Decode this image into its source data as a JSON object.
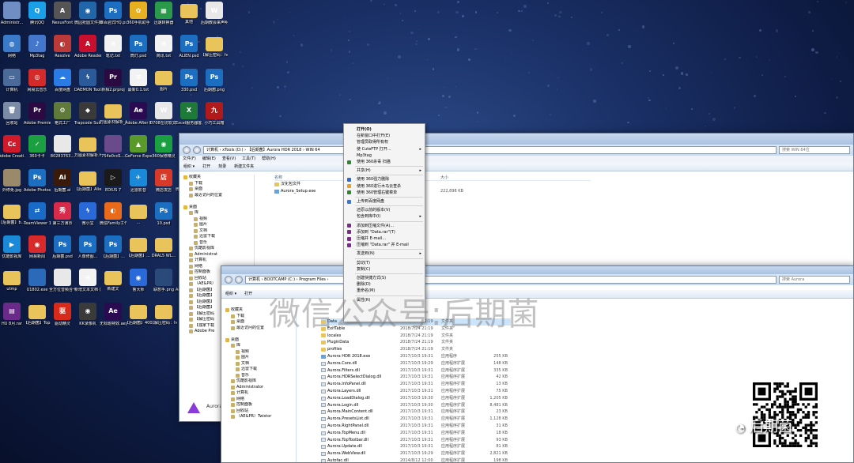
{
  "desktop": {
    "icons": [
      {
        "label": "Administr...",
        "glyph": "",
        "color": "#6f8fc4"
      },
      {
        "label": "腾讯QQ",
        "glyph": "Q",
        "color": "#1aa0e8"
      },
      {
        "label": "NexusFont",
        "glyph": "A",
        "color": "#555555"
      },
      {
        "label": "微园抢圆文件夹.exe",
        "glyph": "◉",
        "color": "#2266aa"
      },
      {
        "label": "谁百验式HQ.psd",
        "glyph": "Ps",
        "color": "#1c6fc0"
      },
      {
        "label": "360手机助手",
        "glyph": "✿",
        "color": "#e6b020"
      },
      {
        "label": "迅速转换器",
        "glyph": "▦",
        "color": "#2a9a4a"
      },
      {
        "label": "其他",
        "glyph": "",
        "color": "#e8c45a"
      },
      {
        "label": "后期教会来声明.docx",
        "glyph": "W",
        "color": "#e8e8e8"
      },
      {
        "label": "网络",
        "glyph": "◍",
        "color": "#3a7ac8"
      },
      {
        "label": "Mp3tag",
        "glyph": "♪",
        "color": "#4477cc"
      },
      {
        "label": "Resolve",
        "glyph": "◐",
        "color": "#ba3a3a"
      },
      {
        "label": "Adobe Reader XI",
        "glyph": "A",
        "color": "#c8102e"
      },
      {
        "label": "笔记.txt",
        "glyph": "≡",
        "color": "#f2f2f2"
      },
      {
        "label": "筒灯.psd",
        "glyph": "Ps",
        "color": "#1c6fc0"
      },
      {
        "label": "简讯.txt",
        "glyph": "≡",
        "color": "#f2f2f2"
      },
      {
        "label": "ALIEN.psd",
        "glyph": "Ps",
        "color": "#1c6fc0"
      },
      {
        "label": "【解压密码：houqi...",
        "glyph": "",
        "color": "#e8c45a"
      },
      {
        "label": "计算机",
        "glyph": "▭",
        "color": "#4a6a9a"
      },
      {
        "label": "网易云音乐",
        "glyph": "◎",
        "color": "#d32a2a"
      },
      {
        "label": "百度网盘",
        "glyph": "☁",
        "color": "#2b7be4"
      },
      {
        "label": "DAEMON Tools Lite",
        "glyph": "ϟ",
        "color": "#2a5a9a"
      },
      {
        "label": "新相2.prproj",
        "glyph": "Pr",
        "color": "#2a0a40"
      },
      {
        "label": "最新0.1.txt",
        "glyph": "≡",
        "color": "#f2f2f2"
      },
      {
        "label": "图片",
        "glyph": "",
        "color": "#e8c45a"
      },
      {
        "label": "330.psd",
        "glyph": "Ps",
        "color": "#1c6fc0"
      },
      {
        "label": "后期菌.png",
        "glyph": "Ps",
        "color": "#1c6fc0"
      },
      {
        "label": "回收站",
        "glyph": "🗑",
        "color": "#7b8da6"
      },
      {
        "label": "Adobe Premie...",
        "glyph": "Pr",
        "color": "#2a0a40"
      },
      {
        "label": "格式工厂",
        "glyph": "⚙",
        "color": "#5f7a3a"
      },
      {
        "label": "Trapcode Suite 12.1...",
        "glyph": "◆",
        "color": "#3a3a3a"
      },
      {
        "label": "万图素材解析_files",
        "glyph": "",
        "color": "#e8c45a"
      },
      {
        "label": "Adobe After Effects CC ...",
        "glyph": "Ae",
        "color": "#2a0a50"
      },
      {
        "label": "0708在坊软文.docx",
        "glyph": "W",
        "color": "#e8e8e8"
      },
      {
        "label": "Excel服务器客户端",
        "glyph": "X",
        "color": "#1f7a3a"
      },
      {
        "label": "小巧工具箱",
        "glyph": "九",
        "color": "#b01a1a"
      },
      {
        "label": "Adobe Creati...",
        "glyph": "Cc",
        "color": "#d01a2a"
      },
      {
        "label": "360卡卡",
        "glyph": "✓",
        "color": "#1aa040"
      },
      {
        "label": "80283763...",
        "glyph": "",
        "color": "#e8e8e8"
      },
      {
        "label": "万图素材解析.html",
        "glyph": "",
        "color": "#e8c45a"
      },
      {
        "label": "754e0cd1...",
        "glyph": "",
        "color": "#6a4a8a"
      },
      {
        "label": "GeForce Experience",
        "glyph": "▲",
        "color": "#5a9a2a"
      },
      {
        "label": "360保修精灵",
        "glyph": "◉",
        "color": "#1aa040"
      },
      {
        "label": "8mg.jpg",
        "glyph": "",
        "color": "#5a6a8a"
      },
      {
        "label": "微小宝-微信运营助手",
        "glyph": "",
        "color": "#e8e8e8"
      },
      {
        "label": "外修免.jpg",
        "glyph": "",
        "color": "#9a8a6a"
      },
      {
        "label": "Adobe Photosh...",
        "glyph": "Ps",
        "color": "#1c6fc0"
      },
      {
        "label": "后期菌.ai",
        "glyph": "Ai",
        "color": "#3a1a0a"
      },
      {
        "label": "【后期菌】Alien Skin...",
        "glyph": "",
        "color": "#e8c45a"
      },
      {
        "label": "EDIUS 7",
        "glyph": "▷",
        "color": "#1a1a1a"
      },
      {
        "label": "迅雷影音",
        "glyph": "✈",
        "color": "#1a8ad8"
      },
      {
        "label": "微店发店",
        "glyph": "店",
        "color": "#d83a2a"
      },
      {
        "label": "微小宝-微信运营助手",
        "glyph": "",
        "color": "#e8c45a"
      },
      {
        "label": "360安全浏览器",
        "glyph": "e",
        "color": "#1aa040"
      },
      {
        "label": "【后期菌】b...",
        "glyph": "",
        "color": "#e8c45a"
      },
      {
        "label": "TeamViewer 13",
        "glyph": "⇄",
        "color": "#1a6ac8"
      },
      {
        "label": "第三方演示",
        "glyph": "秀",
        "color": "#d82a4a"
      },
      {
        "label": "微小宝",
        "glyph": "ϟ",
        "color": "#2a6ad8"
      },
      {
        "label": "微信Family工作平台",
        "glyph": "◐",
        "color": "#e86a1a"
      },
      {
        "label": "...",
        "glyph": "",
        "color": "#e8c45a"
      },
      {
        "label": "10.psd",
        "glyph": "Ps",
        "color": "#1c6fc0"
      },
      {
        "label": "【后期菌】...",
        "glyph": "▤",
        "color": "#6a2a8a"
      },
      {
        "label": "Internet Explorer",
        "glyph": "e",
        "color": "#1a7ad8"
      },
      {
        "label": "优酷影视库",
        "glyph": "▶",
        "color": "#1a8ad8"
      },
      {
        "label": "网易新闻",
        "glyph": "◉",
        "color": "#d82a2a"
      },
      {
        "label": "后期菌.psd",
        "glyph": "Ps",
        "color": "#1c6fc0"
      },
      {
        "label": "人像修图...",
        "glyph": "Ps",
        "color": "#1c6fc0"
      },
      {
        "label": "【后期菌】...",
        "glyph": "Ps",
        "color": "#1c6fc0"
      },
      {
        "label": "【后期菌】...",
        "glyph": "",
        "color": "#e8c45a"
      },
      {
        "label": "DRAL5 WL...",
        "glyph": "",
        "color": "#e8c45a"
      },
      {
        "label": "XPinstaller",
        "glyph": "X",
        "color": "#c82a1a"
      },
      {
        "label": "两个软件已发改规则",
        "glyph": "",
        "color": "#e8e8e8"
      },
      {
        "label": "utmp",
        "glyph": "",
        "color": "#e8c45a"
      },
      {
        "label": "U1802.exe",
        "glyph": "",
        "color": "#2a6ab8"
      },
      {
        "label": "全方位音频合一个月...",
        "glyph": "",
        "color": "#e8e8e8"
      },
      {
        "label": "新增文本文档 (2).txt",
        "glyph": "≡",
        "color": "#f2f2f2"
      },
      {
        "label": "新建文",
        "glyph": "",
        "color": "#e8c45a"
      },
      {
        "label": "鲁大师",
        "glyph": "◉",
        "color": "#2a6ad8"
      },
      {
        "label": "联想手.png",
        "glyph": "",
        "color": "#2a4a7a"
      },
      {
        "label": "Adobe Premie...",
        "glyph": "Pr",
        "color": "#2a0a40"
      },
      {
        "label": "腾讯视频",
        "glyph": "▶",
        "color": "#1a9ad8"
      },
      {
        "label": "HU 8月.rar",
        "glyph": "▤",
        "color": "#6a2a8a"
      },
      {
        "label": "【后期菌】Topaz Re...",
        "glyph": "",
        "color": "#e8c45a"
      },
      {
        "label": "驱动精灵",
        "glyph": "驱",
        "color": "#d82a1a"
      },
      {
        "label": "KK录像机",
        "glyph": "◉",
        "color": "#3a3a3a"
      },
      {
        "label": "无标题特效.aep",
        "glyph": "Ae",
        "color": "#2a0a50"
      },
      {
        "label": "【后期菌】400个文字...",
        "glyph": "",
        "color": "#e8c45a"
      },
      {
        "label": "【解压密码：houqj...",
        "glyph": "",
        "color": "#e8c45a"
      },
      {
        "label": "Aurora",
        "glyph": "▲",
        "color": "#8a3ad8"
      }
    ]
  },
  "window_back": {
    "address": "计算机 › xTools (D:) › 【后期菌】Aurora HDR 2018 › WIN 64",
    "search_placeholder": "搜索 WIN 64位",
    "menu": [
      "文件(F)",
      "编辑(E)",
      "查看(V)",
      "工具(T)",
      "帮助(H)"
    ],
    "toolbar": [
      "组织 ▾",
      "打开",
      "刻录",
      "新建文件夹"
    ],
    "column_name": "名称",
    "column_size": "大小",
    "nav": [
      {
        "label": "收藏夹",
        "level": 0
      },
      {
        "label": "下载",
        "level": 1
      },
      {
        "label": "桌面",
        "level": 1
      },
      {
        "label": "最近访问的位置",
        "level": 1
      },
      {
        "label": "",
        "level": 1
      },
      {
        "label": "桌面",
        "level": 0
      },
      {
        "label": "库",
        "level": 1
      },
      {
        "label": "视频",
        "level": 2
      },
      {
        "label": "图片",
        "level": 2
      },
      {
        "label": "文档",
        "level": 2
      },
      {
        "label": "迅雷下载",
        "level": 2
      },
      {
        "label": "音乐",
        "level": 2
      },
      {
        "label": "优酷影视库",
        "level": 1
      },
      {
        "label": "Administrat",
        "level": 1
      },
      {
        "label": "计算机",
        "level": 1
      },
      {
        "label": "网络",
        "level": 1
      },
      {
        "label": "控制面板",
        "level": 1
      },
      {
        "label": "回收站",
        "level": 1
      },
      {
        "label": "（AE&PR）",
        "level": 1
      },
      {
        "label": "【后期菌】",
        "level": 1
      },
      {
        "label": "【后期菌】",
        "level": 1
      },
      {
        "label": "【后期菌】",
        "level": 1
      },
      {
        "label": "【后期菌】",
        "level": 1
      },
      {
        "label": "【解压密码",
        "level": 1
      },
      {
        "label": "【解压密码",
        "level": 1
      },
      {
        "label": "【独家下载",
        "level": 1
      },
      {
        "label": "Adobe Pre",
        "level": 1
      }
    ],
    "files": [
      {
        "name": "汉化包文件",
        "size": "",
        "type": "folder"
      },
      {
        "name": "Aurora_Setup.exe",
        "size": "222,898 KB",
        "type": "exe"
      }
    ],
    "status_name": "Aurora"
  },
  "window_front": {
    "address": "计算机 › BOOTCAMP (C:) › Program Files ›",
    "search_placeholder": "搜索 Aurora",
    "toolbar": [
      "组织 ▾",
      "打开"
    ],
    "nav": [
      {
        "label": "收藏夹",
        "level": 0
      },
      {
        "label": "下载",
        "level": 1
      },
      {
        "label": "桌面",
        "level": 1
      },
      {
        "label": "最近访问的位置",
        "level": 1
      },
      {
        "label": "",
        "level": 1
      },
      {
        "label": "桌面",
        "level": 0
      },
      {
        "label": "库",
        "level": 1
      },
      {
        "label": "视频",
        "level": 2
      },
      {
        "label": "图片",
        "level": 2
      },
      {
        "label": "文档",
        "level": 2
      },
      {
        "label": "迅雷下载",
        "level": 2
      },
      {
        "label": "音乐",
        "level": 2
      },
      {
        "label": "优酷影视库",
        "level": 1
      },
      {
        "label": "Administrator",
        "level": 1
      },
      {
        "label": "计算机",
        "level": 1
      },
      {
        "label": "网络",
        "level": 1
      },
      {
        "label": "控制面板",
        "level": 1
      },
      {
        "label": "回收站",
        "level": 1
      },
      {
        "label": "（AE&PR）Twistor",
        "level": 1
      }
    ],
    "files": [
      {
        "name": "Data",
        "date": "2018/7/24 21:19",
        "kind": "文件夹",
        "size": "",
        "type": "folder",
        "selected": true
      },
      {
        "name": "ExifTable",
        "date": "2018/7/24 21:19",
        "kind": "文件夹",
        "size": "",
        "type": "folder"
      },
      {
        "name": "locales",
        "date": "2018/7/24 21:19",
        "kind": "文件夹",
        "size": "",
        "type": "folder"
      },
      {
        "name": "PluginData",
        "date": "2018/7/24 21:19",
        "kind": "文件夹",
        "size": "",
        "type": "folder"
      },
      {
        "name": "profiles",
        "date": "2018/7/24 21:19",
        "kind": "文件夹",
        "size": "",
        "type": "folder"
      },
      {
        "name": "Aurora HDR 2018.exe",
        "date": "2017/10/3 19:31",
        "kind": "应用程序",
        "size": "255 KB",
        "type": "exe"
      },
      {
        "name": "Aurora.Core.dll",
        "date": "2017/10/3 19:29",
        "kind": "应用程序扩展",
        "size": "148 KB",
        "type": "dll"
      },
      {
        "name": "Aurora.Filters.dll",
        "date": "2017/10/3 19:31",
        "kind": "应用程序扩展",
        "size": "335 KB",
        "type": "dll"
      },
      {
        "name": "Aurora.HDRSelectDialog.dll",
        "date": "2017/10/3 19:31",
        "kind": "应用程序扩展",
        "size": "42 KB",
        "type": "dll"
      },
      {
        "name": "Aurora.InfoPanel.dll",
        "date": "2017/10/3 19:31",
        "kind": "应用程序扩展",
        "size": "13 KB",
        "type": "dll"
      },
      {
        "name": "Aurora.Layers.dll",
        "date": "2017/10/3 19:31",
        "kind": "应用程序扩展",
        "size": "75 KB",
        "type": "dll"
      },
      {
        "name": "Aurora.LoadDialog.dll",
        "date": "2017/10/3 19:30",
        "kind": "应用程序扩展",
        "size": "1,205 KB",
        "type": "dll"
      },
      {
        "name": "Aurora.Login.dll",
        "date": "2017/10/3 19:30",
        "kind": "应用程序扩展",
        "size": "8,481 KB",
        "type": "dll"
      },
      {
        "name": "Aurora.MainContent.dll",
        "date": "2017/10/3 19:31",
        "kind": "应用程序扩展",
        "size": "23 KB",
        "type": "dll"
      },
      {
        "name": "Aurora.PresetsList.dll",
        "date": "2017/10/3 19:31",
        "kind": "应用程序扩展",
        "size": "1,128 KB",
        "type": "dll"
      },
      {
        "name": "Aurora.RightPanel.dll",
        "date": "2017/10/3 19:31",
        "kind": "应用程序扩展",
        "size": "31 KB",
        "type": "dll"
      },
      {
        "name": "Aurora.TopMenu.dll",
        "date": "2017/10/3 19:31",
        "kind": "应用程序扩展",
        "size": "18 KB",
        "type": "dll"
      },
      {
        "name": "Aurora.TopToolbar.dll",
        "date": "2017/10/3 19:31",
        "kind": "应用程序扩展",
        "size": "93 KB",
        "type": "dll"
      },
      {
        "name": "Aurora.Update.dll",
        "date": "2017/10/3 19:31",
        "kind": "应用程序扩展",
        "size": "81 KB",
        "type": "dll"
      },
      {
        "name": "Aurora.WebView.dll",
        "date": "2017/10/3 19:29",
        "kind": "应用程序扩展",
        "size": "2,821 KB",
        "type": "dll"
      },
      {
        "name": "Autofac.dll",
        "date": "2014/8/12 12:00",
        "kind": "应用程序扩展",
        "size": "198 KB",
        "type": "dll"
      }
    ]
  },
  "context_menu": {
    "items": [
      {
        "label": "打开(O)",
        "bold": true
      },
      {
        "label": "在新窗口中打开(E)"
      },
      {
        "label": "管理员取得所有权"
      },
      {
        "label": "使 CuteFTP 打开...",
        "submenu": true
      },
      {
        "label": "Mp3tag"
      },
      {
        "label": "使用 360杀毒 扫描",
        "icon": "#2a8a2a"
      },
      {
        "sep": true
      },
      {
        "label": "共享(H)",
        "submenu": true
      },
      {
        "sep": true
      },
      {
        "label": "使用 360强力删除",
        "icon": "#2a6ad8"
      },
      {
        "label": "使用 360进行木马云查杀",
        "icon": "#e8a020"
      },
      {
        "label": "使用 360管理右键菜单",
        "icon": "#2a8a2a"
      },
      {
        "sep": true
      },
      {
        "label": "上传到百度网盘",
        "icon": "#2b7be4"
      },
      {
        "sep": true
      },
      {
        "label": "还原以前的版本(V)"
      },
      {
        "label": "包含到库中(I)",
        "submenu": true
      },
      {
        "sep": true
      },
      {
        "label": "添加到压缩文件(A)...",
        "icon": "#7a2a8a"
      },
      {
        "label": "添加到 \"Data.rar\"(T)",
        "icon": "#7a2a8a"
      },
      {
        "label": "压缩并 E-mail...",
        "icon": "#7a2a8a"
      },
      {
        "label": "压缩到 \"Data.rar\" 并 E-mail",
        "icon": "#7a2a8a"
      },
      {
        "sep": true
      },
      {
        "label": "发送到(N)",
        "submenu": true
      },
      {
        "sep": true
      },
      {
        "label": "剪切(T)"
      },
      {
        "label": "复制(C)"
      },
      {
        "sep": true
      },
      {
        "label": "创建快捷方式(S)"
      },
      {
        "label": "删除(D)"
      },
      {
        "label": "重命名(M)"
      },
      {
        "sep": true
      },
      {
        "label": "属性(R)"
      }
    ]
  },
  "watermark": "微信公众号:后期菌",
  "qr_caption": "后期菌"
}
